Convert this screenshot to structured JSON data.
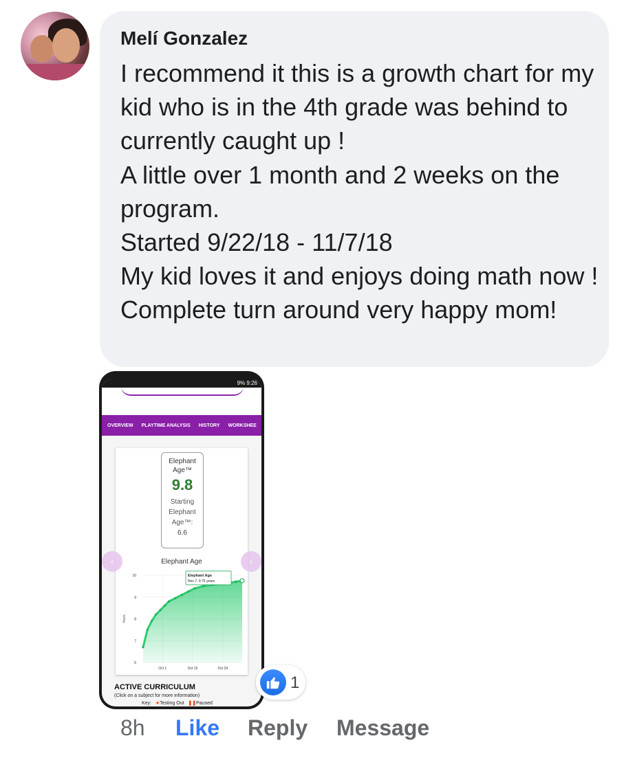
{
  "comment": {
    "author": "Melí Gonzalez",
    "text": "I recommend it this is a growth chart for my kid who is in the 4th grade was behind to currently caught up !\nA little over 1 month and 2 weeks on the program.\nStarted 9/22/18 - 11/7/18\nMy kid loves it and enjoys doing math now ! Complete turn around very happy mom!"
  },
  "attachment": {
    "status_bar": "9% 9:26",
    "tabs": [
      "OVERVIEW",
      "PLAYTIME ANALYSIS",
      "HISTORY",
      "WORKSHEE"
    ],
    "age_label_line1": "Elephant",
    "age_label_line2": "Age™",
    "age_value": "9.8",
    "starting_label_1": "Starting",
    "starting_label_2": "Elephant",
    "starting_label_3": "Age™:",
    "starting_value": "6.6",
    "active_title": "ACTIVE CURRICULUM",
    "active_subtitle": "(Click on a subject for more information)",
    "key_label": "Key:",
    "key_testing": "Testing Out",
    "key_paused": "Paused"
  },
  "chart_data": {
    "type": "area",
    "title": "Elephant Age",
    "xlabel": "",
    "ylabel": "Years",
    "x_ticks": [
      "Oct 1",
      "Oct 15",
      "Oct 29"
    ],
    "y_ticks": [
      "6",
      "7",
      "8",
      "9",
      "10"
    ],
    "ylim": [
      6,
      10
    ],
    "x": [
      "Sep 22",
      "Sep 24",
      "Sep 26",
      "Sep 28",
      "Sep 30",
      "Oct 2",
      "Oct 4",
      "Oct 7",
      "Oct 10",
      "Oct 13",
      "Oct 16",
      "Oct 20",
      "Oct 24",
      "Oct 28",
      "Nov 1",
      "Nov 4",
      "Nov 7"
    ],
    "values": [
      6.7,
      7.5,
      7.9,
      8.2,
      8.4,
      8.6,
      8.8,
      8.95,
      9.1,
      9.25,
      9.4,
      9.5,
      9.55,
      9.6,
      9.65,
      9.7,
      9.75
    ],
    "tooltip": {
      "title": "Elephant Age",
      "text": "Nov 7: 9.75 years"
    }
  },
  "reactions": {
    "count": "1"
  },
  "actions": {
    "time": "8h",
    "like": "Like",
    "reply": "Reply",
    "message": "Message"
  },
  "colors": {
    "bubble": "#eff1f4",
    "tab_purple": "#8a1fa8",
    "chart_green": "#2ecc71",
    "like_blue": "#3478f6"
  }
}
